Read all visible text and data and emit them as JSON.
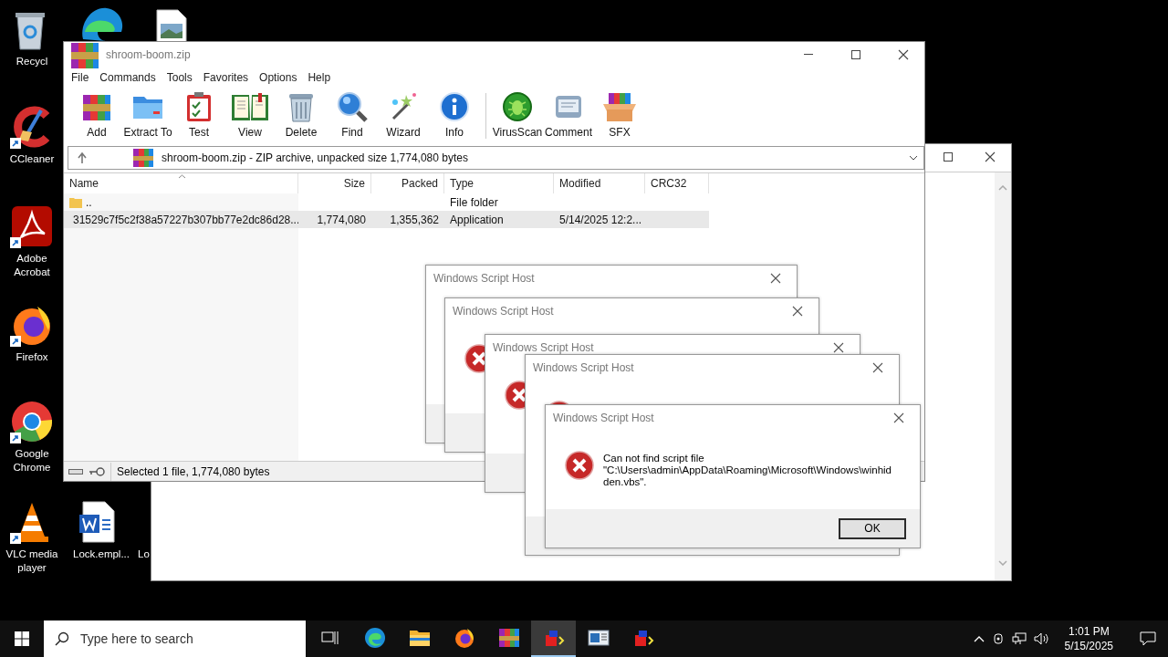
{
  "desktop_icons": [
    {
      "label": "Recycl"
    },
    {
      "label": "CCleaner"
    },
    {
      "label": "Adobe Acrobat"
    },
    {
      "label": "Firefox"
    },
    {
      "label": "Google Chrome"
    },
    {
      "label": "VLC media player"
    },
    {
      "label": "Lock.empl..."
    },
    {
      "label": "Lo"
    }
  ],
  "winrar": {
    "title": "shroom-boom.zip",
    "menu": [
      "File",
      "Commands",
      "Tools",
      "Favorites",
      "Options",
      "Help"
    ],
    "toolbar": [
      "Add",
      "Extract To",
      "Test",
      "View",
      "Delete",
      "Find",
      "Wizard",
      "Info",
      "VirusScan",
      "Comment",
      "SFX"
    ],
    "address": "shroom-boom.zip - ZIP archive, unpacked size 1,774,080 bytes",
    "columns": [
      "Name",
      "Size",
      "Packed",
      "Type",
      "Modified",
      "CRC32"
    ],
    "rows": [
      {
        "kind": "folder",
        "selected": false,
        "name": "..",
        "type": "File folder"
      },
      {
        "kind": "file",
        "selected": true,
        "name": "31529c7f5c2f38a57227b307bb77e2dc86d28...",
        "size": "1,774,080",
        "packed": "1,355,362",
        "type": "Application",
        "modified": "5/14/2025 12:2..."
      }
    ],
    "status": "Selected 1 file, 1,774,080 bytes"
  },
  "dialogs": [
    {
      "title": "Windows Script Host"
    },
    {
      "title": "Windows Script Host"
    },
    {
      "title": "Windows Script Host"
    },
    {
      "title": "Windows Script Host"
    },
    {
      "title": "Windows Script Host",
      "message": "Can not find script file \"C:\\Users\\admin\\AppData\\Roaming\\Microsoft\\Windows\\winhidden.vbs\".",
      "button": "OK"
    }
  ],
  "taskbar": {
    "search_placeholder": "Type here to search",
    "apps": [
      {
        "selected": false
      },
      {
        "selected": false
      },
      {
        "selected": false
      },
      {
        "selected": false
      },
      {
        "selected": false
      },
      {
        "selected": true
      },
      {
        "selected": false
      },
      {
        "selected": false
      }
    ],
    "time": "1:01 PM",
    "date": "5/15/2025"
  }
}
